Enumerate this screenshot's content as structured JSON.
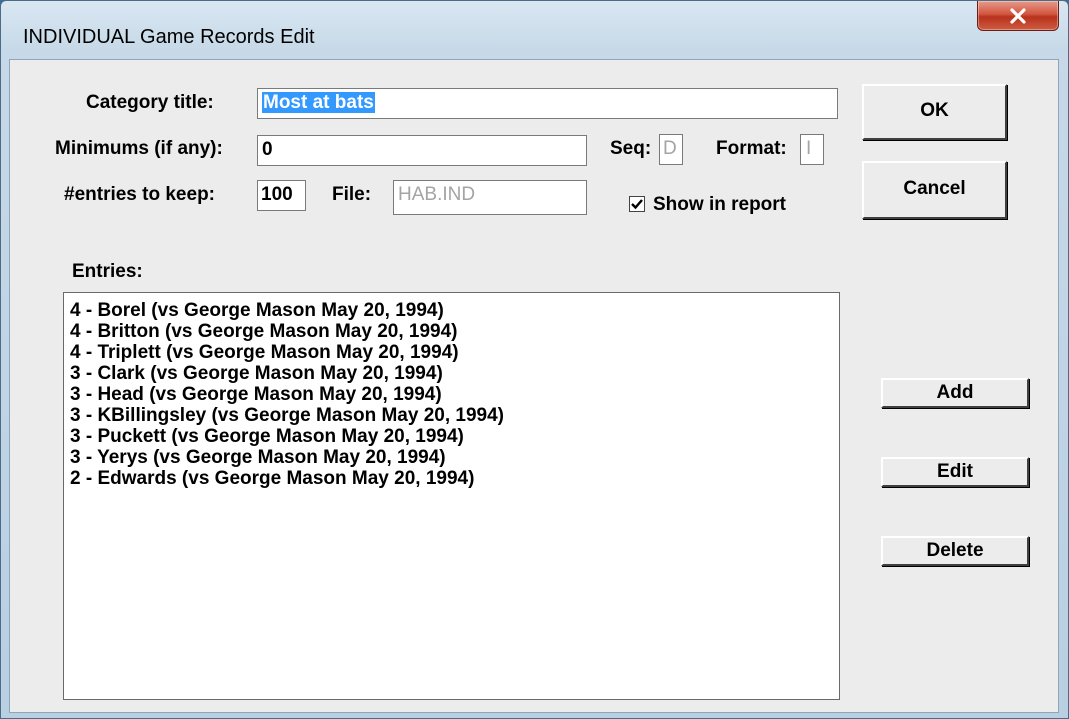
{
  "window": {
    "title": "INDIVIDUAL Game Records Edit"
  },
  "form": {
    "category_title_label": "Category title:",
    "category_title_value": "Most at bats",
    "minimums_label": "Minimums (if any):",
    "minimums_value": "0",
    "seq_label": "Seq:",
    "seq_value": "D",
    "format_label": "Format:",
    "format_value": "I",
    "entries_to_keep_label": "#entries to keep:",
    "entries_to_keep_value": "100",
    "file_label": "File:",
    "file_value": "HAB.IND",
    "show_in_report_label": "Show in report",
    "show_in_report_checked": true,
    "entries_label": "Entries:"
  },
  "buttons": {
    "ok": "OK",
    "cancel": "Cancel",
    "add": "Add",
    "edit": "Edit",
    "delete": "Delete"
  },
  "entries": [
    "4 - Borel (vs George Mason May 20, 1994)",
    "4 - Britton (vs George Mason May 20, 1994)",
    "4 - Triplett (vs George Mason May 20, 1994)",
    "3 - Clark (vs George Mason May 20, 1994)",
    "3 - Head (vs George Mason May 20, 1994)",
    "3 - KBillingsley (vs George Mason May 20, 1994)",
    "3 - Puckett (vs George Mason May 20, 1994)",
    "3 - Yerys (vs George Mason May 20, 1994)",
    "2 - Edwards (vs George Mason May 20, 1994)"
  ]
}
